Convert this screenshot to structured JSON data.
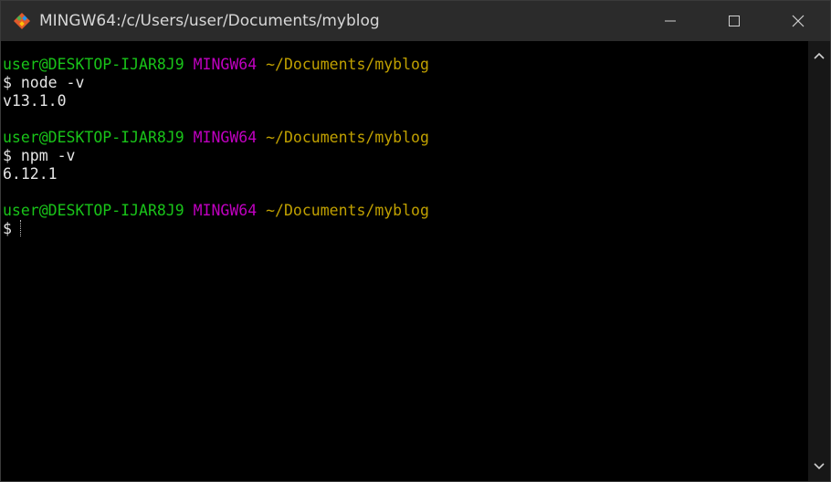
{
  "window": {
    "title": "MINGW64:/c/Users/user/Documents/myblog",
    "icon": "git-bash-icon",
    "controls": [
      "minimize-icon",
      "maximize-icon",
      "close-icon"
    ]
  },
  "terminal": {
    "blocks": [
      {
        "prompt_user": "user@DESKTOP-IJAR8J9",
        "prompt_env": "MINGW64",
        "prompt_path": "~/Documents/myblog",
        "command": "$ node -v",
        "output": "v13.1.0"
      },
      {
        "prompt_user": "user@DESKTOP-IJAR8J9",
        "prompt_env": "MINGW64",
        "prompt_path": "~/Documents/myblog",
        "command": "$ npm -v",
        "output": "6.12.1"
      },
      {
        "prompt_user": "user@DESKTOP-IJAR8J9",
        "prompt_env": "MINGW64",
        "prompt_path": "~/Documents/myblog",
        "command": "$"
      }
    ]
  },
  "colors": {
    "user": "#19c419",
    "env": "#c000c0",
    "path": "#c0a000",
    "text": "#e6e6e6",
    "background": "#000000",
    "titlebar": "#2b2b2b"
  }
}
